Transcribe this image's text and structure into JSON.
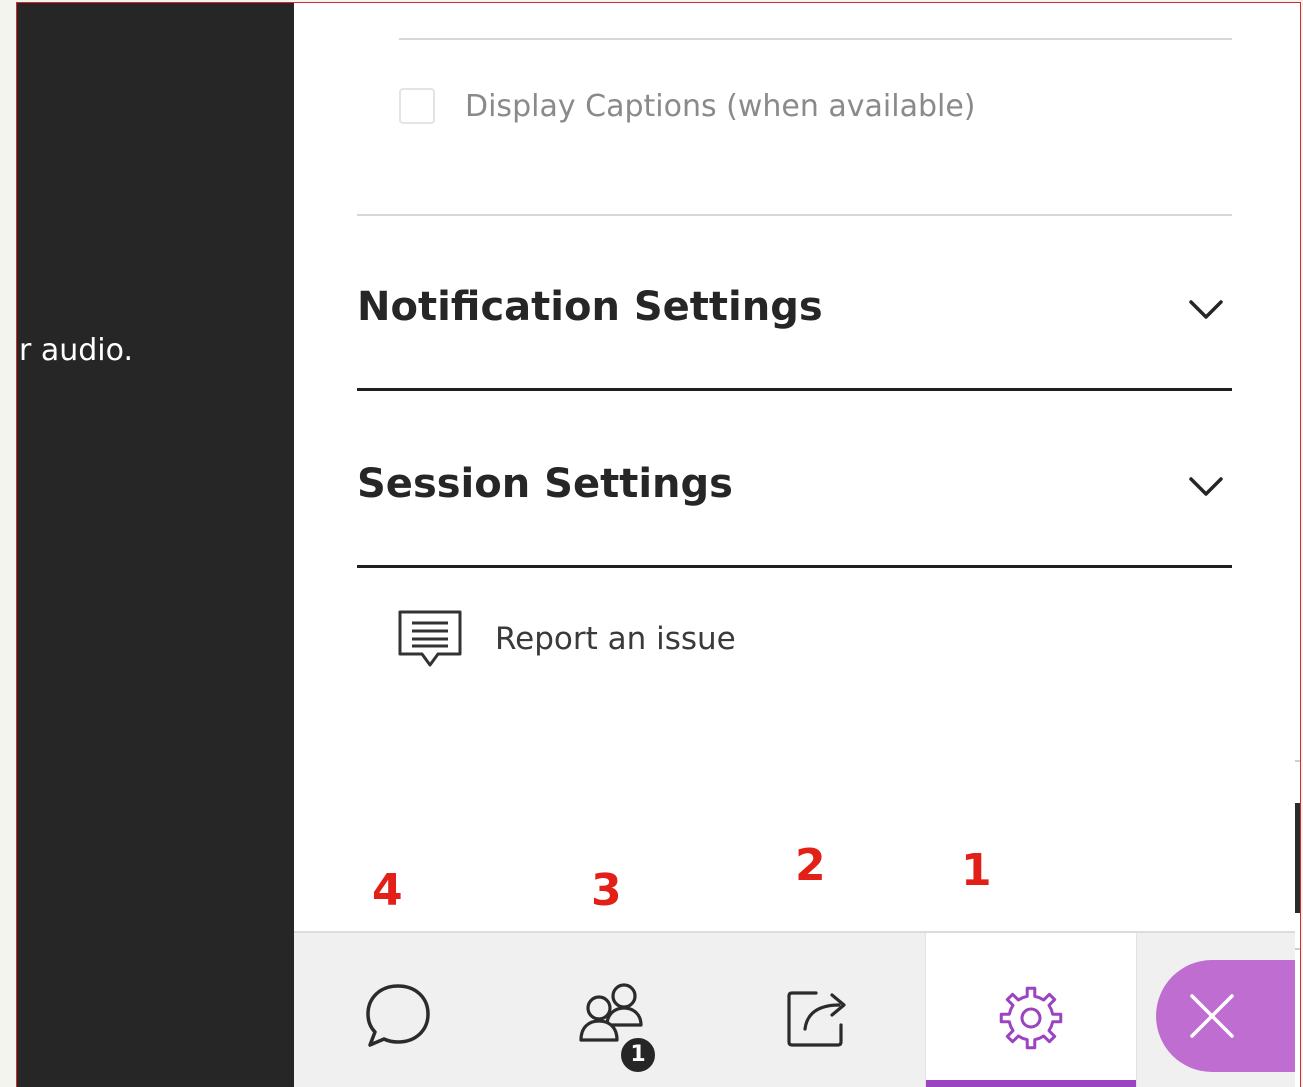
{
  "left_panel": {
    "text": "r audio."
  },
  "settings": {
    "captions_label": "Display Captions (when available)",
    "captions_checked": false,
    "sections": [
      {
        "title": "Notification Settings",
        "expanded": false
      },
      {
        "title": "Session Settings",
        "expanded": false
      }
    ],
    "report_label": "Report an issue"
  },
  "annotations": [
    "4",
    "3",
    "2",
    "1"
  ],
  "toolbar": {
    "buttons": [
      {
        "name": "chat",
        "icon": "chat-bubble-icon"
      },
      {
        "name": "attendees",
        "icon": "attendees-icon",
        "badge": "1"
      },
      {
        "name": "share-content",
        "icon": "share-icon"
      },
      {
        "name": "settings",
        "icon": "gear-icon",
        "active": true
      },
      {
        "name": "close",
        "icon": "close-icon"
      }
    ]
  },
  "colors": {
    "accent": "#9b44c0",
    "close_button": "#c06dd1",
    "annotation": "#e32018",
    "dark_panel": "#262626"
  }
}
